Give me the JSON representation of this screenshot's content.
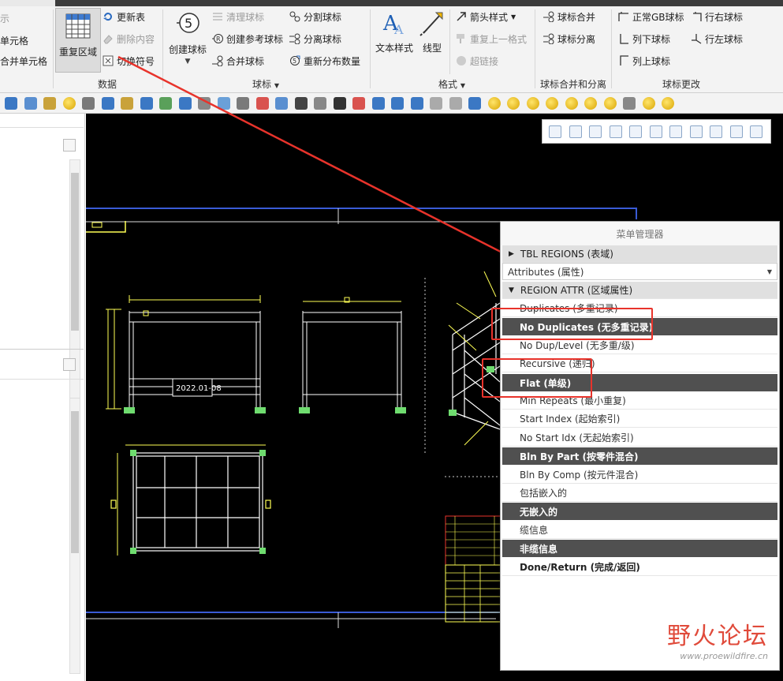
{
  "ribbon": {
    "left_partial": {
      "item1": "示",
      "item2": "单元格",
      "item3": "合并单元格"
    },
    "data_group": {
      "repeat_region": "重复区域",
      "update_table": "更新表",
      "delete_content": "删除内容",
      "switch_symbol": "切换符号",
      "label": "数据"
    },
    "balloon_group": {
      "create_balloon": "创建球标",
      "clear_balloon": "清理球标",
      "create_ref_balloon": "创建参考球标",
      "merge_balloon": "合并球标",
      "split_balloon": "分割球标",
      "detach_balloon": "分离球标",
      "redistribute_qty": "重新分布数量",
      "label": "球标"
    },
    "format_group": {
      "text_style": "文本样式",
      "line_style": "线型",
      "arrow_style": "箭头样式",
      "repeat_format": "重复上一格式",
      "hyperlink": "超链接",
      "label": "格式"
    },
    "merge_group": {
      "merge": "球标合并",
      "detach": "球标分离",
      "label": "球标合并和分离"
    },
    "change_group": {
      "normal_gb": "正常GB球标",
      "col_down": "列下球标",
      "col_up": "列上球标",
      "row_right": "行右球标",
      "row_left": "行左球标",
      "label": "球标更改"
    }
  },
  "menu": {
    "title": "菜单管理器",
    "tbl_regions": "TBL REGIONS (表域)",
    "attributes": "Attributes (属性)",
    "region_attr": "REGION ATTR (区域属性)",
    "items": [
      {
        "label": "Duplicates (多重记录)",
        "selected": false
      },
      {
        "label": "No Duplicates (无多重记录)",
        "selected": true
      },
      {
        "label": "No Dup/Level (无多重/级)",
        "selected": false
      },
      {
        "label": "Recursive (递归)",
        "selected": false
      },
      {
        "label": "Flat (单级)",
        "selected": true
      },
      {
        "label": "Min Repeats (最小重复)",
        "selected": false
      },
      {
        "label": "Start Index (起始索引)",
        "selected": false
      },
      {
        "label": "No Start Idx (无起始索引)",
        "selected": false
      },
      {
        "label": "Bln By Part (按零件混合)",
        "selected": true
      },
      {
        "label": "Bln By Comp (按元件混合)",
        "selected": false
      },
      {
        "label": "包括嵌入的",
        "selected": false
      },
      {
        "label": "无嵌入的",
        "selected": true
      },
      {
        "label": "缆信息",
        "selected": false
      },
      {
        "label": "非缆信息",
        "selected": true
      }
    ],
    "done": "Done/Return (完成/返回)"
  },
  "drawing": {
    "date_stamp": "2022.01-08"
  },
  "watermark": {
    "cn": "野火论坛",
    "url": "www.proewildfire.cn"
  },
  "colors": {
    "accent_red": "#e8332b",
    "drawing_yellow": "#ffff55",
    "drawing_blue": "#3a5bd6",
    "menu_selected": "#505050"
  }
}
